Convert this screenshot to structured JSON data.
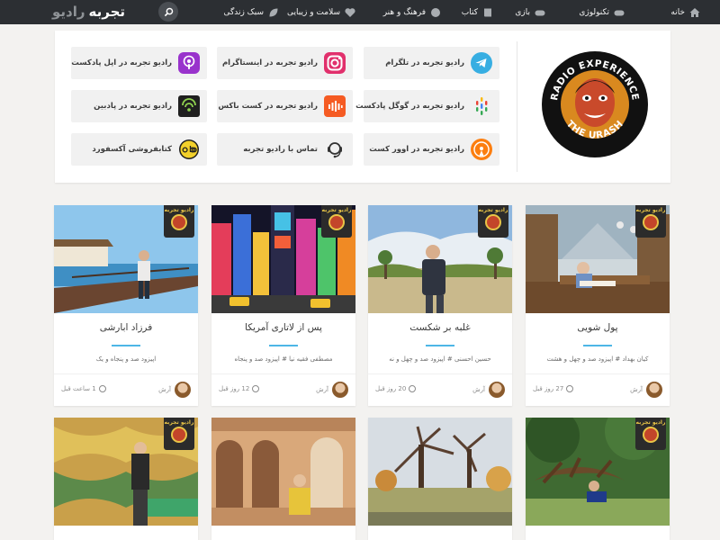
{
  "brand": {
    "part1": "تجربه",
    "part2": "رادیو"
  },
  "nav": [
    {
      "label": "خانه",
      "icon": "home-icon"
    },
    {
      "label": "تکنولوژی",
      "icon": "gamepad-icon"
    },
    {
      "label": "بازی",
      "icon": "gamepad-icon"
    },
    {
      "label": "کتاب",
      "icon": "book-icon"
    },
    {
      "label": "فرهنگ و هنر",
      "icon": "palette-icon"
    },
    {
      "label": "سلامت و زیبایی",
      "icon": "heartbeat-icon"
    },
    {
      "label": "سبک زندگی",
      "icon": "leaf-icon"
    }
  ],
  "links": [
    {
      "label": "رادیو تجربه در تلگرام",
      "icon": "telegram-icon",
      "color": "#37aee2"
    },
    {
      "label": "رادیو تجربه در اینستاگرام",
      "icon": "instagram-icon",
      "color": "#e1306c"
    },
    {
      "label": "رادیو تجربه در اپل پادکست",
      "icon": "apple-podcasts-icon",
      "color": "#9933cc"
    },
    {
      "label": "رادیو تجربه در گوگل پادکست",
      "icon": "google-podcasts-icon",
      "color": "#4285f4"
    },
    {
      "label": "رادیو تجربه در کست باکس",
      "icon": "castbox-icon",
      "color": "#f55b23"
    },
    {
      "label": "رادیو تجربه در پادبین",
      "icon": "podbean-icon",
      "color": "#1f1f1f"
    },
    {
      "label": "رادیو تجربه در اوور کست",
      "icon": "overcast-icon",
      "color": "#fc7e0f"
    },
    {
      "label": "تماس با رادیو تجربه",
      "icon": "support-icon",
      "color": "#333333"
    },
    {
      "label": "کتابفروشی آکسفورد",
      "icon": "oxford-icon",
      "color": "#1f1f1f"
    }
  ],
  "logo": {
    "top_text": "RADIO EXPERIENCE",
    "bottom_text": "THE URASH"
  },
  "card_badge": "رادیو تجربه",
  "cards": [
    {
      "title": "پول شویی",
      "meta": "کیان بهداد # اپیزود صد و چهل و هشت",
      "author": "آرش",
      "time": "27 روز قبل"
    },
    {
      "title": "غلبه بر شکست",
      "meta": "حسین احسنی # اپیزود صد و چهل و نه",
      "author": "آرش",
      "time": "20 روز قبل"
    },
    {
      "title": "پس از لاتاری آمریکا",
      "meta": "مصطفی فقیه نیا # اپیزود صد و پنجاه",
      "author": "آرش",
      "time": "12 روز قبل"
    },
    {
      "title": "فرزاد ابارشی",
      "meta": "اپیزود صد و پنجاه و یک",
      "author": "آرش",
      "time": "1 ساعت قبل"
    },
    {
      "title": "",
      "meta": "",
      "author": "",
      "time": ""
    },
    {
      "title": "",
      "meta": "",
      "author": "",
      "time": ""
    },
    {
      "title": "",
      "meta": "",
      "author": "",
      "time": ""
    },
    {
      "title": "",
      "meta": "",
      "author": "",
      "time": ""
    }
  ]
}
